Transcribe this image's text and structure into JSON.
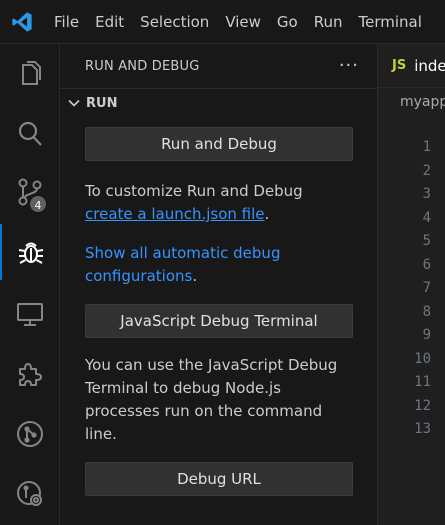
{
  "menubar": {
    "items": [
      "File",
      "Edit",
      "Selection",
      "View",
      "Go",
      "Run",
      "Terminal"
    ]
  },
  "activitybar": {
    "items": [
      {
        "icon": "explorer-icon"
      },
      {
        "icon": "search-icon"
      },
      {
        "icon": "source-control-icon",
        "badge": "4"
      },
      {
        "icon": "run-debug-icon",
        "active": true
      },
      {
        "icon": "remote-explorer-icon"
      },
      {
        "icon": "extensions-icon"
      },
      {
        "icon": "git-icon"
      },
      {
        "icon": "git-settings-icon"
      }
    ]
  },
  "sidebar": {
    "title": "RUN AND DEBUG",
    "section": "RUN",
    "run_button": "Run and Debug",
    "customize_text": "To customize Run and Debug ",
    "customize_link": "create a launch.json file",
    "customize_end": ".",
    "show_link": "Show all automatic debug configurations",
    "show_end": ".",
    "js_terminal_button": "JavaScript Debug Terminal",
    "terminal_text": "You can use the JavaScript Debug Terminal to debug Node.js processes run on the command line.",
    "debug_url_button": "Debug URL"
  },
  "editor": {
    "tab_icon": "JS",
    "tab_name": "index.js",
    "breadcrumb": "myapp",
    "line_numbers": [
      "1",
      "2",
      "3",
      "4",
      "5",
      "6",
      "7",
      "8",
      "9",
      "10",
      "11",
      "12",
      "13"
    ]
  },
  "colors": {
    "accent": "#0078d4",
    "link": "#3794ff",
    "background": "#181818"
  }
}
